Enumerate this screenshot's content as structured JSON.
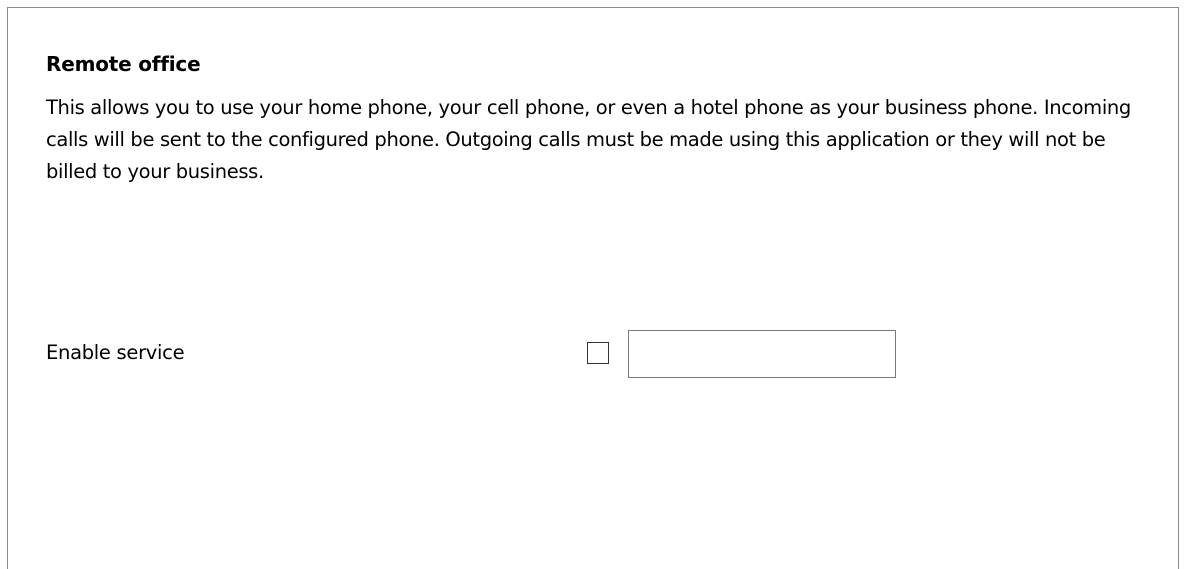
{
  "section": {
    "title": "Remote office",
    "description": "This allows you to use your home phone, your cell phone, or even a hotel phone as your business phone. Incoming calls will be sent to the configured phone. Outgoing calls must be made using this application or they will not be billed to your business."
  },
  "enable_service": {
    "label": "Enable service",
    "checked": false,
    "phone_value": "",
    "phone_placeholder": ""
  }
}
